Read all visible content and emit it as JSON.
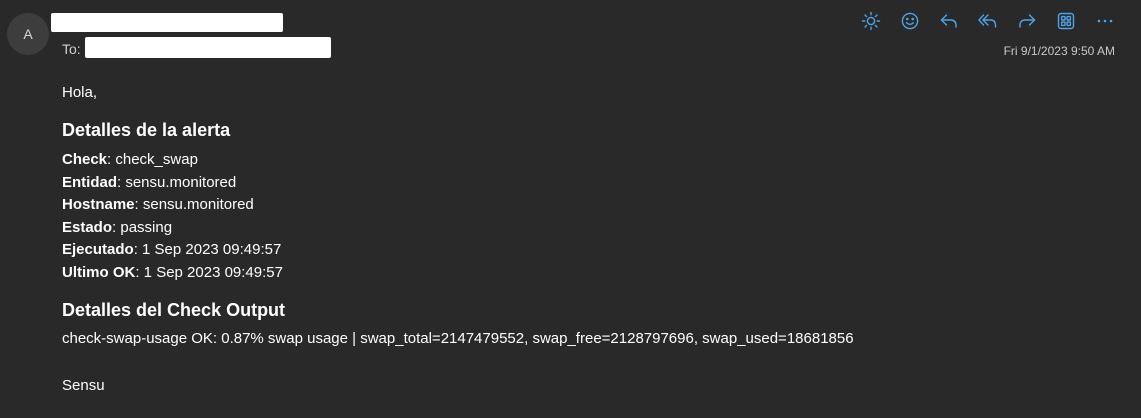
{
  "header": {
    "avatar_initial": "A",
    "to_label": "To:",
    "timestamp": "Fri 9/1/2023 9:50 AM"
  },
  "toolbar": {
    "accent_color": "#4da3e8",
    "icons": [
      "sun-icon",
      "smiley-icon",
      "reply-icon",
      "reply-all-icon",
      "forward-icon",
      "apps-icon",
      "more-icon"
    ]
  },
  "message": {
    "greeting": "Hola,",
    "alert_heading": "Detalles de la alerta",
    "fields": [
      {
        "label": "Check",
        "value": ": check_swap"
      },
      {
        "label": "Entidad",
        "value": ": sensu.monitored"
      },
      {
        "label": "Hostname",
        "value": ": sensu.monitored"
      },
      {
        "label": "Estado",
        "value": ": passing"
      },
      {
        "label": "Ejecutado",
        "value": ": 1 Sep 2023 09:49:57"
      },
      {
        "label": "Ultimo OK",
        "value": ": 1 Sep 2023 09:49:57"
      }
    ],
    "output_heading": "Detalles del Check Output",
    "output": "check-swap-usage OK: 0.87% swap usage | swap_total=2147479552, swap_free=2128797696, swap_used=18681856",
    "signature": "Sensu"
  }
}
